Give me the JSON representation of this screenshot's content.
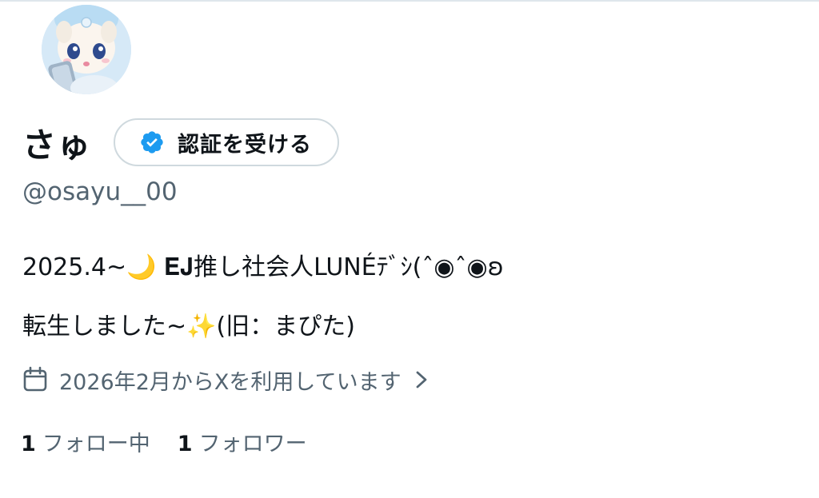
{
  "profile": {
    "display_name": "さゅ",
    "verify_button_label": "認証を受ける",
    "handle": "@osayu__00",
    "bio_line1": "2025.4~🌙 𝐄𝐉推し社会人LUNÉﾃﾞｼ(ˆ◉ˆ◉ʚ",
    "bio_line2": "転生しました~✨(旧：まぴた)",
    "joined_text": "2026年2月からXを利用しています",
    "following_count": "1",
    "following_label": "フォロー中",
    "followers_count": "1",
    "followers_label": "フォロワー"
  },
  "colors": {
    "text_primary": "#0f1419",
    "text_secondary": "#536471",
    "verified_blue": "#1d9bf0",
    "button_border": "#cfd9de"
  },
  "icons": {
    "verified": "verified-badge-icon",
    "calendar": "calendar-icon",
    "chevron": "chevron-right-icon",
    "avatar": "avatar-image"
  }
}
